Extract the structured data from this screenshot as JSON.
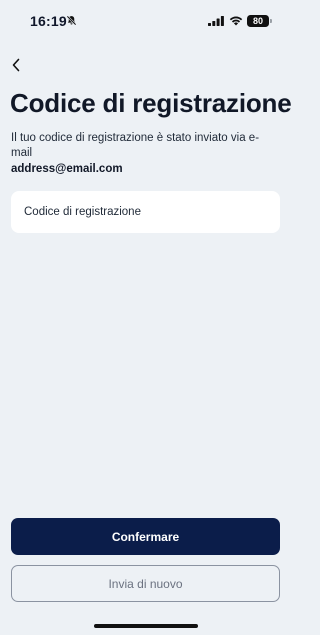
{
  "status_bar": {
    "time": "16:19",
    "battery": "80"
  },
  "header": {
    "title": "Codice di registrazione"
  },
  "content": {
    "subtitle": "Il tuo codice di registrazione è stato inviato via e-mail",
    "email": "address@email.com"
  },
  "form": {
    "code_placeholder": "Codice di registrazione",
    "code_value": ""
  },
  "actions": {
    "confirm_label": "Confermare",
    "resend_label": "Invia di nuovo"
  },
  "colors": {
    "background": "#edf1f5",
    "primary": "#0b1d4a",
    "secondary_border": "#8b93a1"
  },
  "icons": {
    "back": "chevron-left-icon",
    "bell": "bell-slash-icon",
    "signal": "cellular-signal-icon",
    "wifi": "wifi-icon",
    "battery": "battery-icon"
  }
}
